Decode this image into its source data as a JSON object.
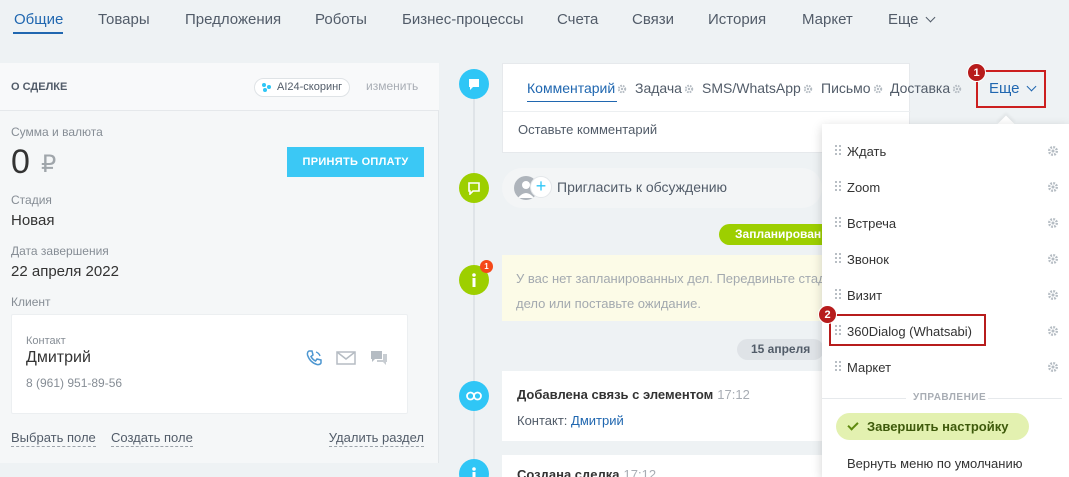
{
  "top_tabs": [
    "Общие",
    "Товары",
    "Предложения",
    "Роботы",
    "Бизнес-процессы",
    "Счета",
    "Связи",
    "История",
    "Маркет",
    "Еще"
  ],
  "deal": {
    "section_title": "О СДЕЛКЕ",
    "ai_badge": "AI24-скоринг",
    "edit_link": "изменить",
    "amount_label": "Сумма и валюта",
    "amount": "0",
    "currency": "₽",
    "pay_button": "ПРИНЯТЬ ОПЛАТУ",
    "stage_label": "Стадия",
    "stage": "Новая",
    "close_date_label": "Дата завершения",
    "close_date": "22 апреля 2022",
    "client_label": "Клиент",
    "contact_label": "Контакт",
    "contact_name": "Дмитрий",
    "contact_phone": "8 (961) 951-89-56",
    "select_field": "Выбрать поле",
    "create_field": "Создать поле",
    "delete_section": "Удалить раздел"
  },
  "editor": {
    "tabs": [
      "Комментарий",
      "Задача",
      "SMS/WhatsApp",
      "Письмо",
      "Доставка"
    ],
    "more": "Еще",
    "placeholder": "Оставьте комментарий"
  },
  "timeline": {
    "invite": "Пригласить к обсуждению",
    "planned_pill": "Запланирован",
    "notice_badge": "1",
    "notice_line1": "У вас нет запланированных дел. Передвиньте стад",
    "notice_line2": "дело или поставьте ожидание.",
    "date_pill": "15 апреля",
    "event1_title": "Добавлена связь с элементом",
    "event1_time": "17:12",
    "event1_prefix": "Контакт:",
    "event1_link": "Дмитрий",
    "event2_title": "Создана сделка",
    "event2_time": "17:12"
  },
  "menu": {
    "items": [
      "Ждать",
      "Zoom",
      "Встреча",
      "Звонок",
      "Визит",
      "360Dialog (Whatsabi)",
      "Маркет"
    ],
    "group_label": "УПРАВЛЕНИЕ",
    "finish_button": "Завершить настройку",
    "reset": "Вернуть меню по умолчанию"
  },
  "markers": [
    "1",
    "2"
  ],
  "colors": {
    "accent": "#2067b0",
    "timeline_blue": "#2fc6f6",
    "timeline_green": "#9dcf00",
    "highlight": "#cc1f1f",
    "pay_button": "#3bc8f5"
  }
}
